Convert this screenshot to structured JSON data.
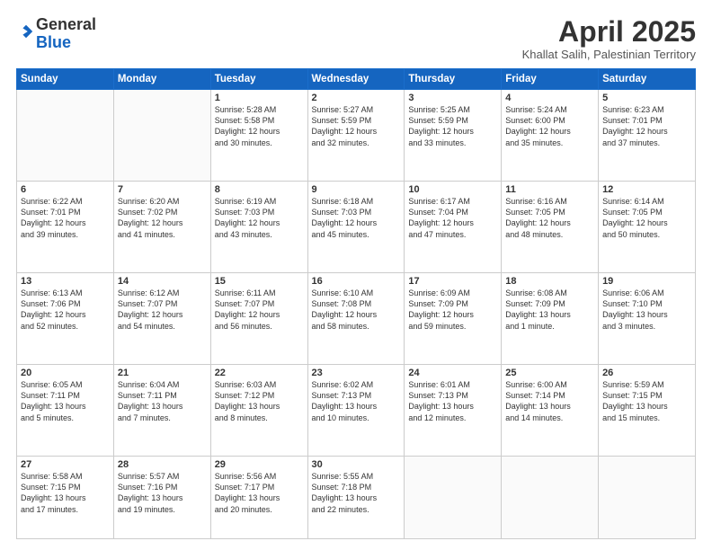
{
  "logo": {
    "general": "General",
    "blue": "Blue"
  },
  "header": {
    "month_year": "April 2025",
    "subtitle": "Khallat Salih, Palestinian Territory"
  },
  "weekdays": [
    "Sunday",
    "Monday",
    "Tuesday",
    "Wednesday",
    "Thursday",
    "Friday",
    "Saturday"
  ],
  "weeks": [
    [
      {
        "day": "",
        "text": ""
      },
      {
        "day": "",
        "text": ""
      },
      {
        "day": "1",
        "text": "Sunrise: 5:28 AM\nSunset: 5:58 PM\nDaylight: 12 hours\nand 30 minutes."
      },
      {
        "day": "2",
        "text": "Sunrise: 5:27 AM\nSunset: 5:59 PM\nDaylight: 12 hours\nand 32 minutes."
      },
      {
        "day": "3",
        "text": "Sunrise: 5:25 AM\nSunset: 5:59 PM\nDaylight: 12 hours\nand 33 minutes."
      },
      {
        "day": "4",
        "text": "Sunrise: 5:24 AM\nSunset: 6:00 PM\nDaylight: 12 hours\nand 35 minutes."
      },
      {
        "day": "5",
        "text": "Sunrise: 6:23 AM\nSunset: 7:01 PM\nDaylight: 12 hours\nand 37 minutes."
      }
    ],
    [
      {
        "day": "6",
        "text": "Sunrise: 6:22 AM\nSunset: 7:01 PM\nDaylight: 12 hours\nand 39 minutes."
      },
      {
        "day": "7",
        "text": "Sunrise: 6:20 AM\nSunset: 7:02 PM\nDaylight: 12 hours\nand 41 minutes."
      },
      {
        "day": "8",
        "text": "Sunrise: 6:19 AM\nSunset: 7:03 PM\nDaylight: 12 hours\nand 43 minutes."
      },
      {
        "day": "9",
        "text": "Sunrise: 6:18 AM\nSunset: 7:03 PM\nDaylight: 12 hours\nand 45 minutes."
      },
      {
        "day": "10",
        "text": "Sunrise: 6:17 AM\nSunset: 7:04 PM\nDaylight: 12 hours\nand 47 minutes."
      },
      {
        "day": "11",
        "text": "Sunrise: 6:16 AM\nSunset: 7:05 PM\nDaylight: 12 hours\nand 48 minutes."
      },
      {
        "day": "12",
        "text": "Sunrise: 6:14 AM\nSunset: 7:05 PM\nDaylight: 12 hours\nand 50 minutes."
      }
    ],
    [
      {
        "day": "13",
        "text": "Sunrise: 6:13 AM\nSunset: 7:06 PM\nDaylight: 12 hours\nand 52 minutes."
      },
      {
        "day": "14",
        "text": "Sunrise: 6:12 AM\nSunset: 7:07 PM\nDaylight: 12 hours\nand 54 minutes."
      },
      {
        "day": "15",
        "text": "Sunrise: 6:11 AM\nSunset: 7:07 PM\nDaylight: 12 hours\nand 56 minutes."
      },
      {
        "day": "16",
        "text": "Sunrise: 6:10 AM\nSunset: 7:08 PM\nDaylight: 12 hours\nand 58 minutes."
      },
      {
        "day": "17",
        "text": "Sunrise: 6:09 AM\nSunset: 7:09 PM\nDaylight: 12 hours\nand 59 minutes."
      },
      {
        "day": "18",
        "text": "Sunrise: 6:08 AM\nSunset: 7:09 PM\nDaylight: 13 hours\nand 1 minute."
      },
      {
        "day": "19",
        "text": "Sunrise: 6:06 AM\nSunset: 7:10 PM\nDaylight: 13 hours\nand 3 minutes."
      }
    ],
    [
      {
        "day": "20",
        "text": "Sunrise: 6:05 AM\nSunset: 7:11 PM\nDaylight: 13 hours\nand 5 minutes."
      },
      {
        "day": "21",
        "text": "Sunrise: 6:04 AM\nSunset: 7:11 PM\nDaylight: 13 hours\nand 7 minutes."
      },
      {
        "day": "22",
        "text": "Sunrise: 6:03 AM\nSunset: 7:12 PM\nDaylight: 13 hours\nand 8 minutes."
      },
      {
        "day": "23",
        "text": "Sunrise: 6:02 AM\nSunset: 7:13 PM\nDaylight: 13 hours\nand 10 minutes."
      },
      {
        "day": "24",
        "text": "Sunrise: 6:01 AM\nSunset: 7:13 PM\nDaylight: 13 hours\nand 12 minutes."
      },
      {
        "day": "25",
        "text": "Sunrise: 6:00 AM\nSunset: 7:14 PM\nDaylight: 13 hours\nand 14 minutes."
      },
      {
        "day": "26",
        "text": "Sunrise: 5:59 AM\nSunset: 7:15 PM\nDaylight: 13 hours\nand 15 minutes."
      }
    ],
    [
      {
        "day": "27",
        "text": "Sunrise: 5:58 AM\nSunset: 7:15 PM\nDaylight: 13 hours\nand 17 minutes."
      },
      {
        "day": "28",
        "text": "Sunrise: 5:57 AM\nSunset: 7:16 PM\nDaylight: 13 hours\nand 19 minutes."
      },
      {
        "day": "29",
        "text": "Sunrise: 5:56 AM\nSunset: 7:17 PM\nDaylight: 13 hours\nand 20 minutes."
      },
      {
        "day": "30",
        "text": "Sunrise: 5:55 AM\nSunset: 7:18 PM\nDaylight: 13 hours\nand 22 minutes."
      },
      {
        "day": "",
        "text": ""
      },
      {
        "day": "",
        "text": ""
      },
      {
        "day": "",
        "text": ""
      }
    ]
  ]
}
